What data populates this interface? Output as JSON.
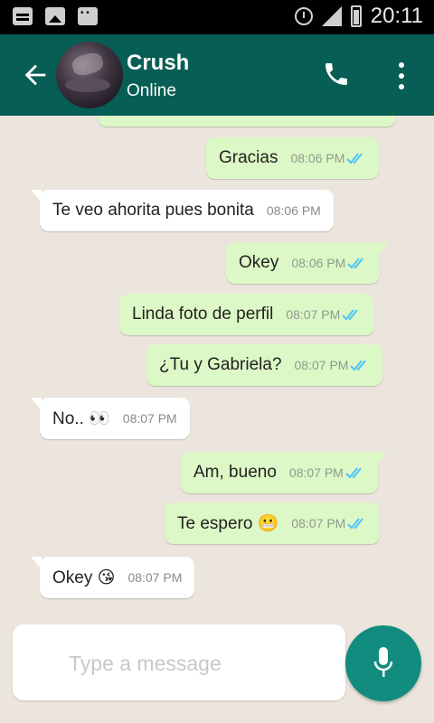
{
  "status_bar": {
    "time": "20:11"
  },
  "header": {
    "contact_name": "Crush",
    "contact_status": "Online"
  },
  "messages": [
    {
      "direction": "out",
      "text": "Gracias",
      "time": "08:06 PM",
      "ticks": "read"
    },
    {
      "direction": "in",
      "text": "Te veo ahorita pues bonita",
      "time": "08:06 PM"
    },
    {
      "direction": "out",
      "text": "Okey",
      "time": "08:06 PM",
      "ticks": "read"
    },
    {
      "direction": "out",
      "text": "Linda foto de perfil",
      "time": "08:07 PM",
      "ticks": "read"
    },
    {
      "direction": "out",
      "text": "¿Tu y Gabriela?",
      "time": "08:07 PM",
      "ticks": "read"
    },
    {
      "direction": "in",
      "text": "No.. 👀",
      "time": "08:07 PM"
    },
    {
      "direction": "out",
      "text": "Am, bueno",
      "time": "08:07 PM",
      "ticks": "read"
    },
    {
      "direction": "out",
      "text": "Te espero 😬",
      "time": "08:07 PM",
      "ticks": "read"
    },
    {
      "direction": "in",
      "text": "Okey 😘",
      "time": "08:07 PM"
    }
  ],
  "composer": {
    "placeholder": "Type a message"
  },
  "colors": {
    "header": "#075e54",
    "outgoing_bubble": "#dcf8c6",
    "incoming_bubble": "#ffffff",
    "read_ticks": "#4fc3f7",
    "mic_button": "#128c7e"
  },
  "icons": {
    "back": "arrow-left-icon",
    "call": "phone-icon",
    "menu": "more-vertical-icon",
    "mic": "microphone-icon"
  }
}
